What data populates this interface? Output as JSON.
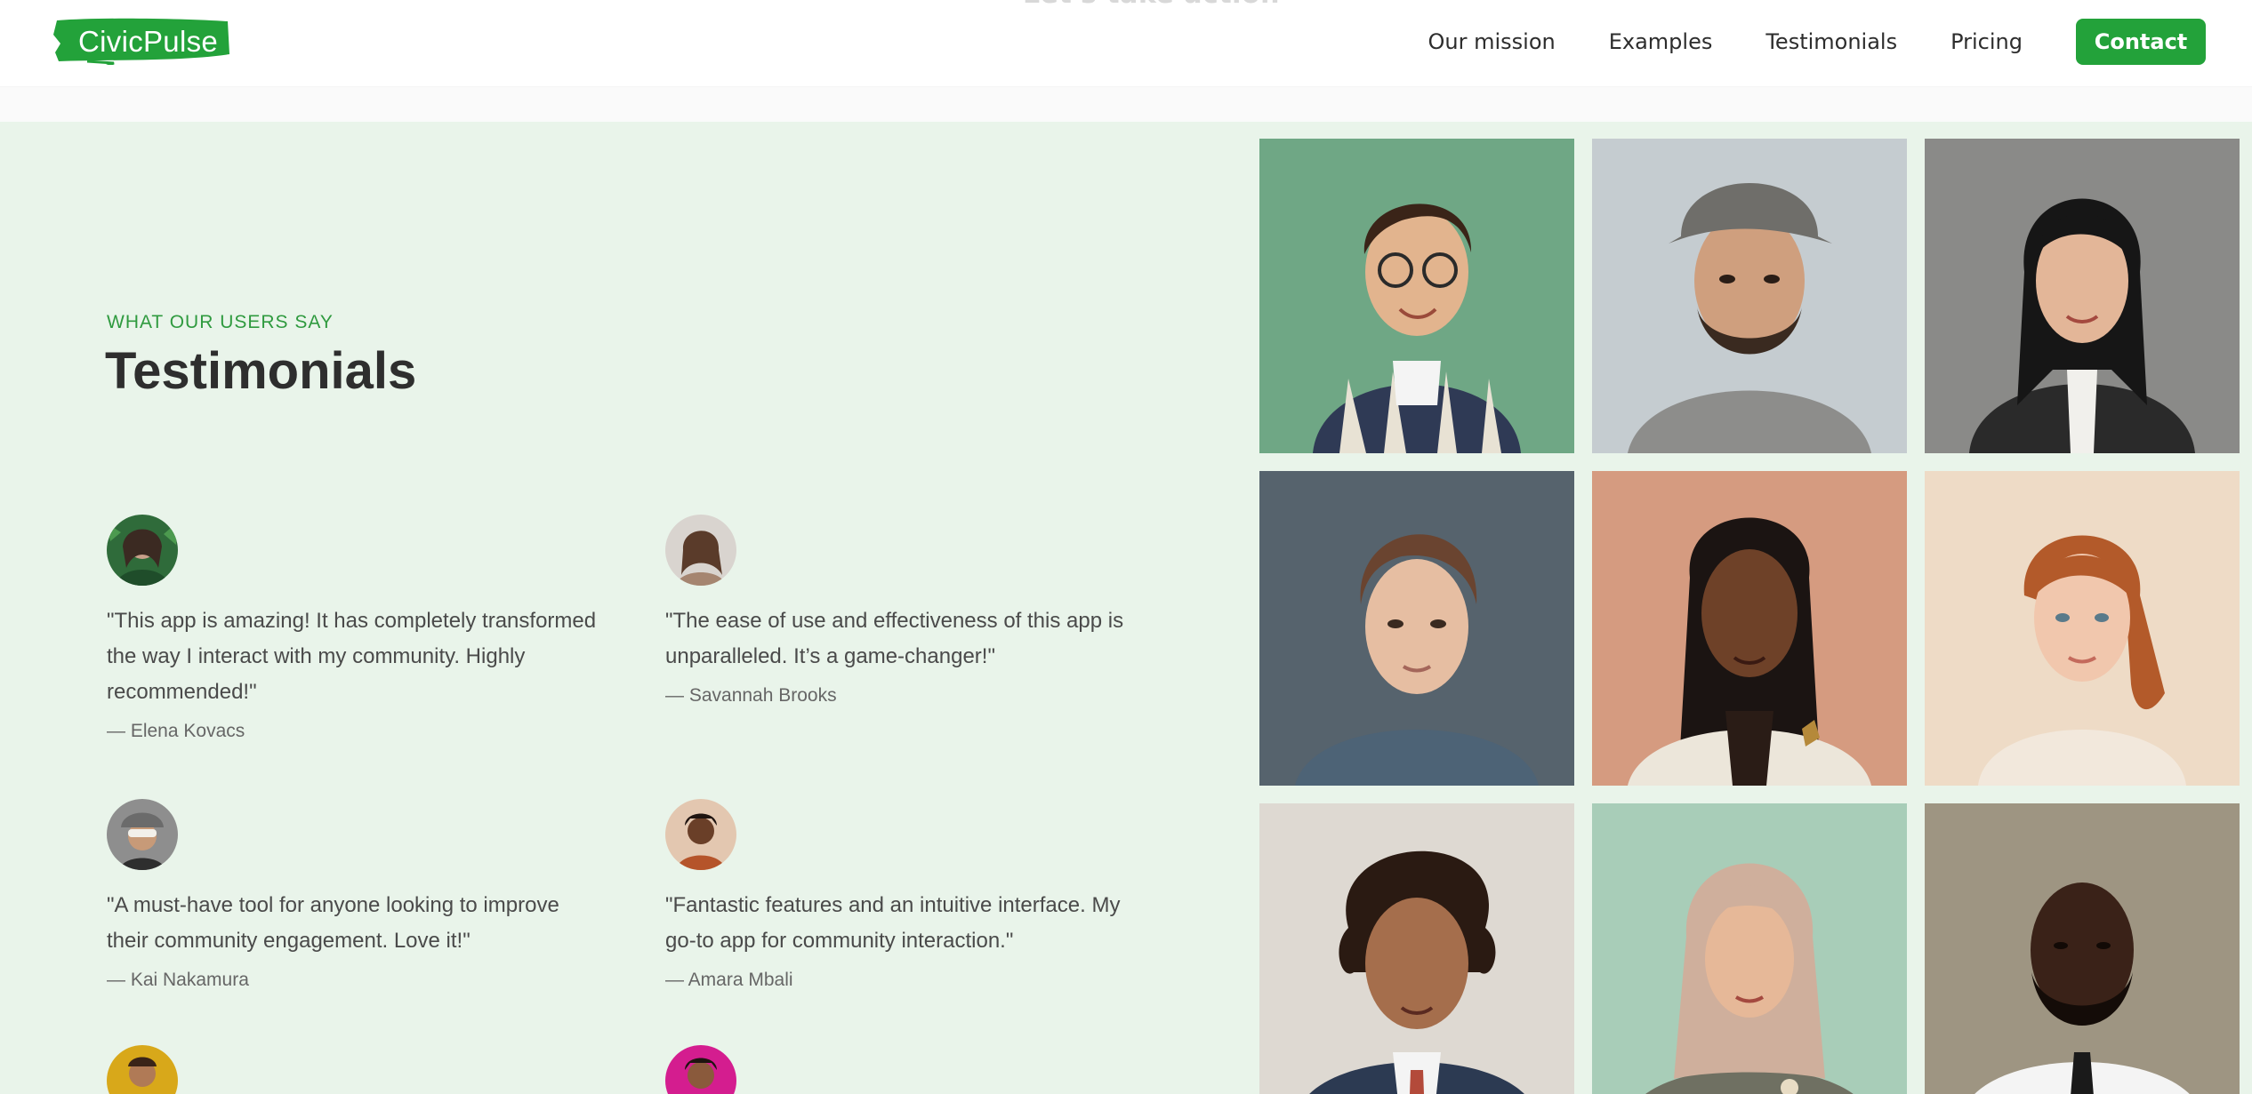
{
  "header": {
    "ghost_text": "Let's take action",
    "logo_text": "CivicPulse",
    "nav": [
      "Our mission",
      "Examples",
      "Testimonials",
      "Pricing"
    ],
    "contact_label": "Contact"
  },
  "section": {
    "eyebrow": "WHAT OUR USERS SAY",
    "title": "Testimonials"
  },
  "testimonials": [
    {
      "quote": "\"This app is amazing! It has completely transformed the way I interact with my community. Highly recommended!\"",
      "author": "— Elena Kovacs"
    },
    {
      "quote": "\"The ease of use and effectiveness of this app is unparalleled. It’s a game-changer!\"",
      "author": "— Savannah Brooks"
    },
    {
      "quote": "\"A must-have tool for anyone looking to improve their community engagement. Love it!\"",
      "author": "— Kai Nakamura"
    },
    {
      "quote": "\"Fantastic features and an intuitive interface. My go-to app for community interaction.\"",
      "author": "— Amara Mbali"
    }
  ],
  "colors": {
    "brand_green": "#23a23a",
    "section_bg": "#e9f4ea",
    "eyebrow": "#2f9a3f"
  }
}
